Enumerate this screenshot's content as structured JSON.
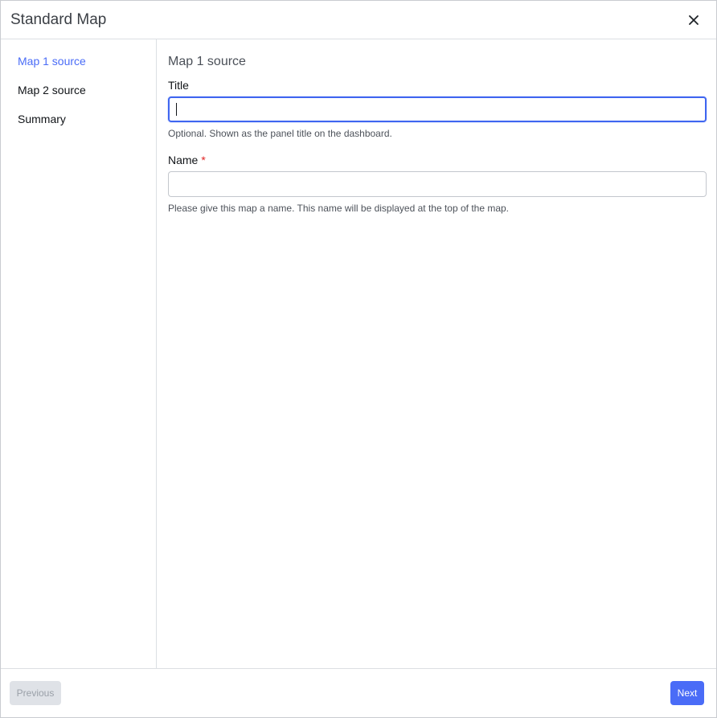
{
  "dialog": {
    "title": "Standard Map",
    "close_icon": "close-icon"
  },
  "sidebar": {
    "items": [
      {
        "label": "Map 1 source",
        "active": true
      },
      {
        "label": "Map 2 source",
        "active": false
      },
      {
        "label": "Summary",
        "active": false
      }
    ]
  },
  "main": {
    "section_title": "Map 1 source",
    "title_field": {
      "label": "Title",
      "value": "",
      "help": "Optional. Shown as the panel title on the dashboard."
    },
    "name_field": {
      "label": "Name",
      "required_marker": "*",
      "value": "",
      "help": "Please give this map a name. This name will be displayed at the top of the map."
    }
  },
  "footer": {
    "previous_label": "Previous",
    "next_label": "Next"
  },
  "colors": {
    "accent": "#4a6cf7",
    "required": "#e02424"
  }
}
